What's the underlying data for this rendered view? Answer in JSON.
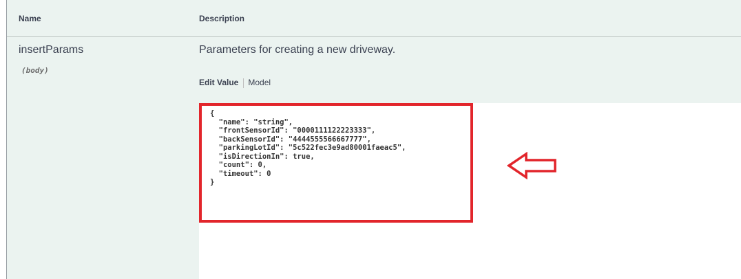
{
  "table": {
    "headers": {
      "name": "Name",
      "description": "Description"
    }
  },
  "parameter": {
    "name": "insertParams",
    "in": "(body)",
    "description": "Parameters for creating a new driveway."
  },
  "tabs": {
    "edit_value": "Edit Value",
    "model": "Model"
  },
  "body_value": "{\n  \"name\": \"string\",\n  \"frontSensorId\": \"0000111122223333\",\n  \"backSensorId\": \"4444555566667777\",\n  \"parkingLotId\": \"5c522fec3e9ad80001faeac5\",\n  \"isDirectionIn\": true,\n  \"count\": 0,\n  \"timeout\": 0\n}",
  "colors": {
    "highlight": "#e2252b",
    "panel": "#ebf3f0"
  },
  "icons": {
    "annotation": "left-arrow-icon"
  }
}
